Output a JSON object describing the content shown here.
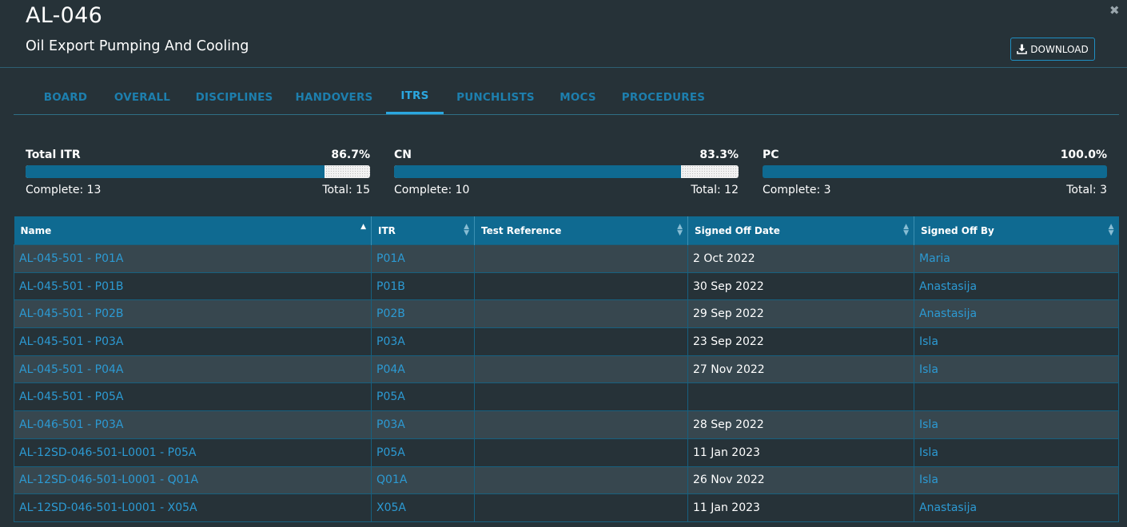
{
  "header": {
    "title": "AL-046",
    "subtitle": "Oil Export Pumping And Cooling",
    "close_glyph": "✖",
    "download_label": "DOWNLOAD"
  },
  "tabs": [
    "BOARD",
    "OVERALL",
    "DISCIPLINES",
    "HANDOVERS",
    "ITRS",
    "PUNCHLISTS",
    "MOCS",
    "PROCEDURES"
  ],
  "active_tab": "ITRS",
  "stats": [
    {
      "label": "Total ITR",
      "percent": "86.7%",
      "fraction": 0.867,
      "complete": "Complete: 13",
      "total": "Total: 15"
    },
    {
      "label": "CN",
      "percent": "83.3%",
      "fraction": 0.833,
      "complete": "Complete: 10",
      "total": "Total: 12"
    },
    {
      "label": "PC",
      "percent": "100.0%",
      "fraction": 1.0,
      "complete": "Complete: 3",
      "total": "Total: 3"
    }
  ],
  "table": {
    "columns": [
      "Name",
      "ITR",
      "Test Reference",
      "Signed Off Date",
      "Signed Off By"
    ],
    "rows": [
      {
        "name": "AL-045-501 - P01A",
        "itr": "P01A",
        "test_reference": "",
        "signed_off_date": "2 Oct 2022",
        "signed_off_by": "Maria"
      },
      {
        "name": "AL-045-501 - P01B",
        "itr": "P01B",
        "test_reference": "",
        "signed_off_date": "30 Sep 2022",
        "signed_off_by": "Anastasija"
      },
      {
        "name": "AL-045-501 - P02B",
        "itr": "P02B",
        "test_reference": "",
        "signed_off_date": "29 Sep 2022",
        "signed_off_by": "Anastasija"
      },
      {
        "name": "AL-045-501 - P03A",
        "itr": "P03A",
        "test_reference": "",
        "signed_off_date": "23 Sep 2022",
        "signed_off_by": "Isla"
      },
      {
        "name": "AL-045-501 - P04A",
        "itr": "P04A",
        "test_reference": "",
        "signed_off_date": "27 Nov 2022",
        "signed_off_by": "Isla"
      },
      {
        "name": "AL-045-501 - P05A",
        "itr": "P05A",
        "test_reference": "",
        "signed_off_date": "",
        "signed_off_by": ""
      },
      {
        "name": "AL-046-501 - P03A",
        "itr": "P03A",
        "test_reference": "",
        "signed_off_date": "28 Sep 2022",
        "signed_off_by": "Isla"
      },
      {
        "name": "AL-12SD-046-501-L0001 - P05A",
        "itr": "P05A",
        "test_reference": "",
        "signed_off_date": "11 Jan 2023",
        "signed_off_by": "Isla"
      },
      {
        "name": "AL-12SD-046-501-L0001 - Q01A",
        "itr": "Q01A",
        "test_reference": "",
        "signed_off_date": "26 Nov 2022",
        "signed_off_by": "Isla"
      },
      {
        "name": "AL-12SD-046-501-L0001 - X05A",
        "itr": "X05A",
        "test_reference": "",
        "signed_off_date": "11 Jan 2023",
        "signed_off_by": "Anastasija"
      }
    ]
  },
  "colors": {
    "background": "#263238",
    "row_alt": "#37474f",
    "accent": "#0f6a91",
    "link": "#2c9ad3",
    "tab_active": "#2ba7e0"
  },
  "icons": {
    "download": "download-icon",
    "close": "close-icon",
    "sort": "sort-icon"
  }
}
